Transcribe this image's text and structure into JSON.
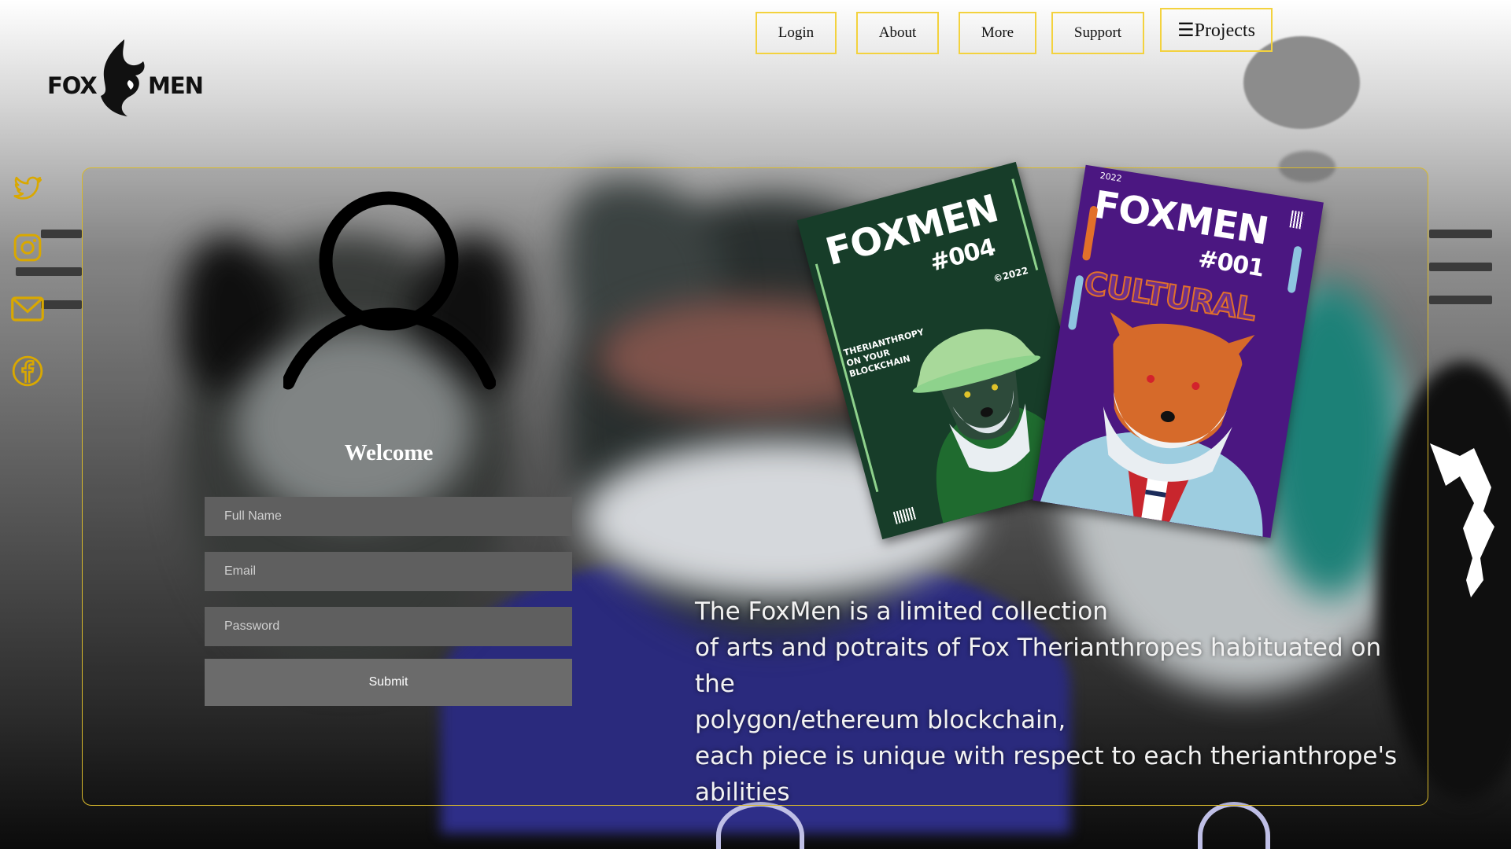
{
  "brand": {
    "logo_left": "FOX",
    "logo_right": "MEN"
  },
  "nav": {
    "login": "Login",
    "about": "About",
    "more": "More",
    "support": "Support",
    "projects": "☰Projects"
  },
  "socials": [
    "twitter-icon",
    "instagram-icon",
    "mail-icon",
    "facebook-icon"
  ],
  "form": {
    "title": "Welcome",
    "full_name_placeholder": "Full Name",
    "email_placeholder": "Email",
    "password_placeholder": "Password",
    "submit_label": "Submit"
  },
  "covers": [
    {
      "title": "FOXMEN",
      "number": "#004",
      "copyright": "©2022",
      "tagline": [
        "THERIANTHROPY",
        "ON YOUR",
        "BLOCKCHAIN"
      ],
      "color": "#173d29"
    },
    {
      "title": "FOXMEN",
      "number": "#001",
      "year": "2022",
      "subtitle": "CULTURAL",
      "color": "#4b1781"
    }
  ],
  "description": [
    "The FoxMen is a limited collection",
    "of arts and potraits of Fox Therianthropes habituated on the",
    "polygon/ethereum blockchain,",
    "each piece is unique with respect to each therianthrope's",
    "abilities"
  ],
  "colors": {
    "accent": "#f3d23e",
    "card_border": "#d8b92c",
    "field_bg": "#5f5f5f",
    "submit_bg": "#6b6b6b"
  }
}
